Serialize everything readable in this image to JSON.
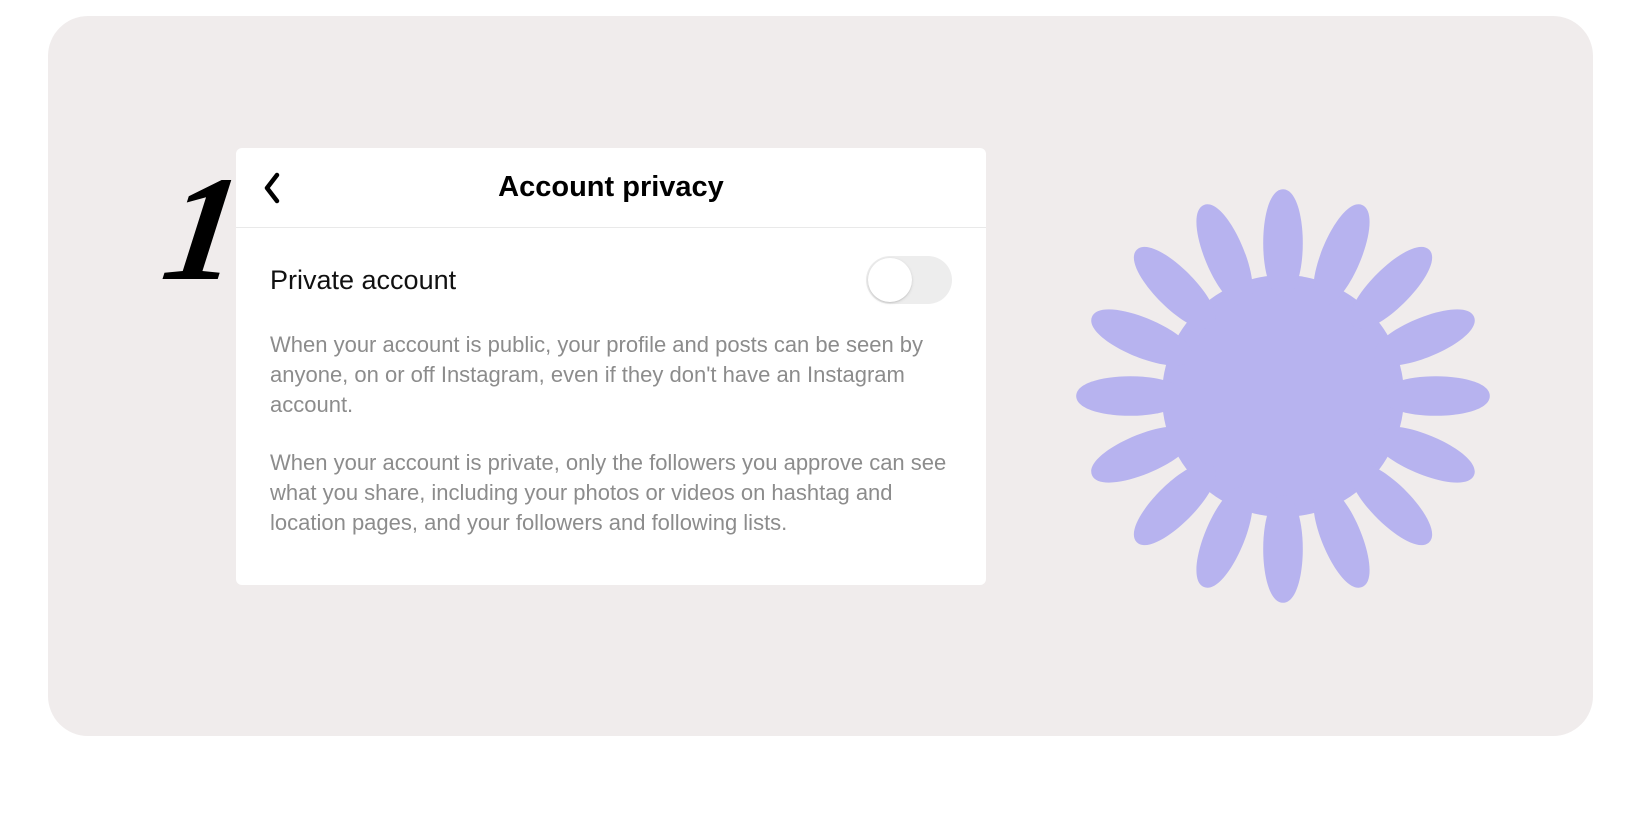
{
  "step": "1",
  "header": {
    "title": "Account privacy"
  },
  "setting": {
    "label": "Private account",
    "enabled": false
  },
  "descriptions": {
    "public": "When your account is public, your profile and posts can be seen by anyone, on or off Instagram, even if they don't have an Instagram account.",
    "private": "When your account is private, only the followers you approve can see what you share, including your photos or videos on hashtag and location pages, and your followers and following lists."
  },
  "decoration": {
    "starburst_color": "#b7b3ef"
  }
}
